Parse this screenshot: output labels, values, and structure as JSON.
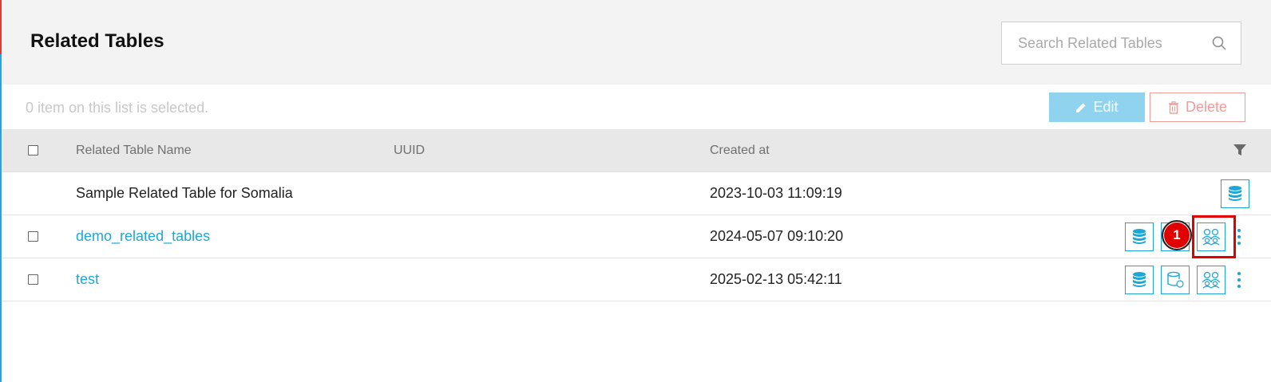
{
  "page": {
    "title": "Related Tables",
    "search_placeholder": "Search Related Tables"
  },
  "toolbar": {
    "selection_text": "0 item on this list is selected.",
    "edit_label": "Edit",
    "delete_label": "Delete"
  },
  "table": {
    "columns": [
      "Related Table Name",
      "UUID",
      "Created at"
    ],
    "rows": [
      {
        "name": "Sample Related Table for Somalia",
        "uuid": "",
        "created_at": "2023-10-03 11:09:19",
        "is_link": false,
        "selectable": false,
        "actions": [
          "database-icon"
        ]
      },
      {
        "name": "demo_related_tables",
        "uuid": "",
        "created_at": "2024-05-07 09:10:20",
        "is_link": true,
        "selectable": true,
        "actions": [
          "database-icon",
          "database-settings-icon",
          "users-icon"
        ]
      },
      {
        "name": "test",
        "uuid": "",
        "created_at": "2025-02-13 05:42:11",
        "is_link": true,
        "selectable": true,
        "actions": [
          "database-icon",
          "database-settings-icon",
          "users-icon"
        ]
      }
    ]
  },
  "annotation": {
    "step_number": "1"
  },
  "colors": {
    "accent": "#1ea7d6",
    "header_bg": "#f3f3f3",
    "edit_bg": "#8fd3ef",
    "delete_border": "#f19b9b",
    "highlight": "#e00000"
  }
}
